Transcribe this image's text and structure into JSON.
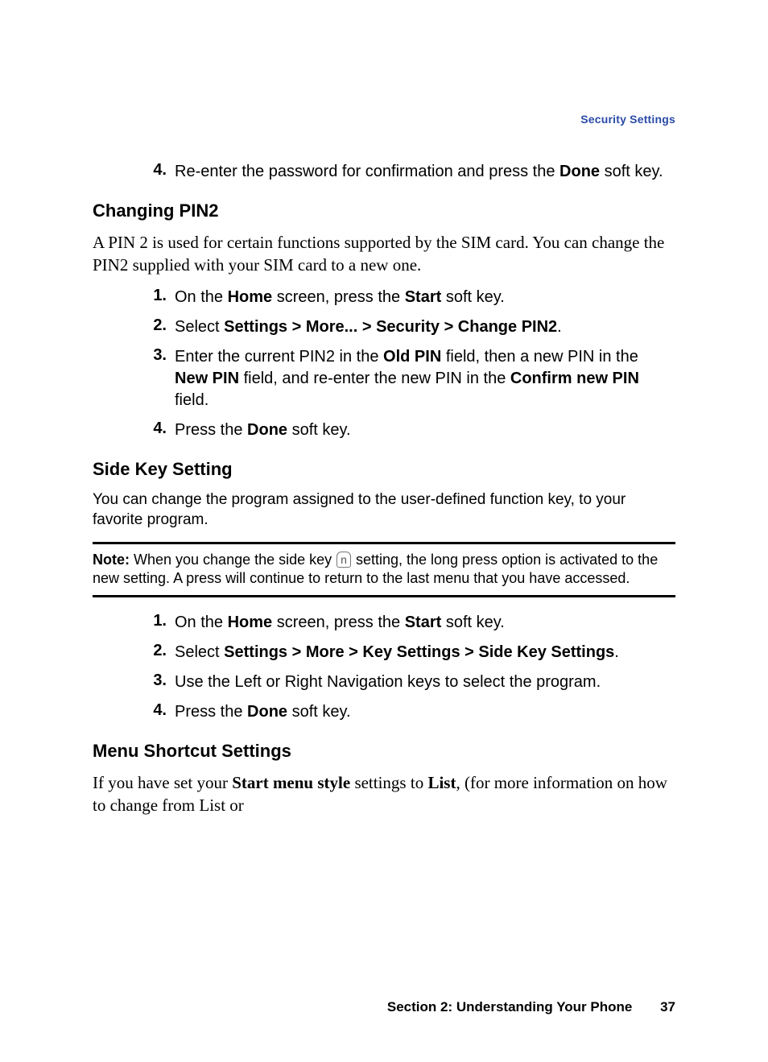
{
  "header": {
    "section_label": "Security Settings"
  },
  "step4_intro": {
    "num": "4.",
    "pre": "Re-enter the password for confirmation and press the ",
    "bold": "Done",
    "post": " soft key."
  },
  "changing_pin2": {
    "heading": "Changing PIN2",
    "para": "A PIN 2 is used for certain functions supported by the SIM card. You can change the PIN2 supplied with your SIM card to a new one.",
    "steps": {
      "s1": {
        "num": "1.",
        "t0": "On the ",
        "b0": "Home",
        "t1": " screen, press the ",
        "b1": "Start",
        "t2": " soft key."
      },
      "s2": {
        "num": "2.",
        "t0": "Select ",
        "b0": "Settings > More... > Security > Change PIN2",
        "t1": "."
      },
      "s3": {
        "num": "3.",
        "t0": "Enter the current PIN2 in the ",
        "b0": "Old PIN",
        "t1": " field, then a new PIN in the ",
        "b1": "New PIN",
        "t2": " field, and re-enter the new PIN in the ",
        "b2": "Confirm new PIN",
        "t3": " field."
      },
      "s4": {
        "num": "4.",
        "t0": "Press the ",
        "b0": "Done",
        "t1": " soft key."
      }
    }
  },
  "side_key": {
    "heading": "Side Key Setting",
    "para": "You can change the program assigned to the user-defined function key, to your favorite program.",
    "note": {
      "label": "Note:",
      "pre": " When you change the side key ",
      "icon": "n",
      "post": " setting, the long press option is activated to the new setting. A press will continue to return to the last menu that you have accessed."
    },
    "steps": {
      "s1": {
        "num": "1.",
        "t0": "On the ",
        "b0": "Home",
        "t1": " screen, press the ",
        "b1": "Start",
        "t2": " soft key."
      },
      "s2": {
        "num": "2.",
        "t0": "Select ",
        "b0": "Settings > More > Key Settings > Side Key Settings",
        "t1": "."
      },
      "s3": {
        "num": "3.",
        "t0": "Use the Left or Right Navigation keys to select the program."
      },
      "s4": {
        "num": "4.",
        "t0": "Press the ",
        "b0": "Done",
        "t1": " soft key."
      }
    }
  },
  "menu_shortcut": {
    "heading": "Menu Shortcut Settings",
    "para": {
      "t0": "If you have set your ",
      "b0": "Start menu style",
      "t1": " settings to ",
      "b1": "List",
      "t2": ", (for more information on how to change from List or"
    }
  },
  "footer": {
    "section": "Section 2: Understanding Your Phone",
    "page": "37"
  }
}
